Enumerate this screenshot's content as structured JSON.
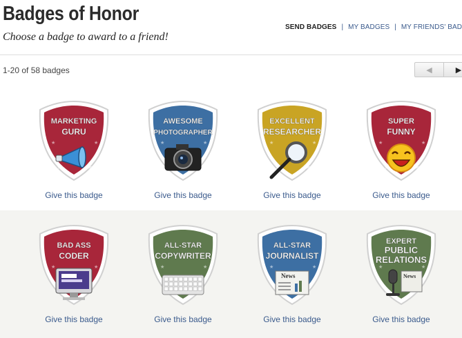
{
  "header": {
    "title": "Badges of Honor",
    "subtitle": "Choose a badge to award to a friend!"
  },
  "nav": {
    "send": "SEND BADGES",
    "mine": "MY BADGES",
    "friends": "MY FRIENDS' BADGES",
    "separator": "|"
  },
  "toolbar": {
    "count": "1-20 of 58 badges",
    "prev_icon": "◀",
    "next_icon": "▶"
  },
  "badges": [
    {
      "line1": "MARKETING",
      "line2": "GURU",
      "color": "#a8263a",
      "icon": "megaphone-icon",
      "action": "Give this badge"
    },
    {
      "line1": "AWESOME",
      "line2": "PHOTOGRAPHER",
      "color": "#3d6fa3",
      "icon": "camera-icon",
      "action": "Give this badge"
    },
    {
      "line1": "EXCELLENT",
      "line2": "RESEARCHER",
      "color": "#c9a424",
      "icon": "magnifier-icon",
      "action": "Give this badge"
    },
    {
      "line1": "SUPER",
      "line2": "FUNNY",
      "color": "#a8263a",
      "icon": "laughing-face-icon",
      "action": "Give this badge"
    },
    {
      "line1": "BAD ASS",
      "line2": "CODER",
      "color": "#a8263a",
      "icon": "computer-icon",
      "action": "Give this badge"
    },
    {
      "line1": "ALL-STAR",
      "line2": "COPYWRITER",
      "color": "#5f7a4e",
      "icon": "keyboard-icon",
      "action": "Give this badge"
    },
    {
      "line1": "ALL-STAR",
      "line2": "JOURNALIST",
      "color": "#3d6fa3",
      "icon": "newspaper-icon",
      "action": "Give this badge"
    },
    {
      "line1": "EXPERT",
      "line2": "PUBLIC",
      "line3": "RELATIONS",
      "color": "#5f7a4e",
      "icon": "microphone-icon",
      "action": "Give this badge"
    }
  ]
}
